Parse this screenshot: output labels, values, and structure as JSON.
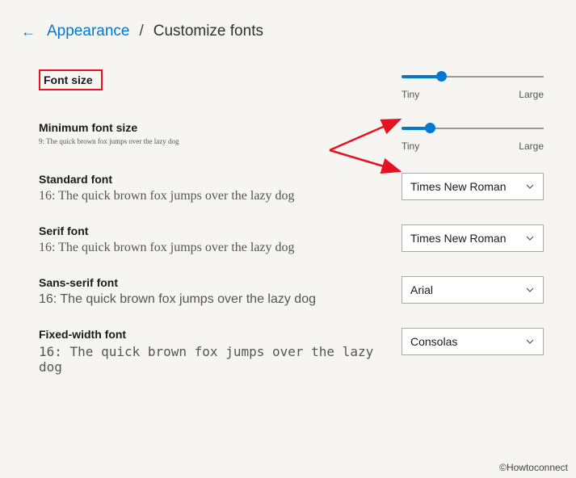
{
  "breadcrumb": {
    "back_icon": "←",
    "link": "Appearance",
    "separator": "/",
    "current": "Customize fonts"
  },
  "font_size": {
    "label": "Font size",
    "slider": {
      "min_label": "Tiny",
      "max_label": "Large",
      "percent": 28
    }
  },
  "min_font_size": {
    "label": "Minimum font size",
    "sample": "9: The quick brown fox jumps over the lazy dog",
    "slider": {
      "min_label": "Tiny",
      "max_label": "Large",
      "percent": 20
    }
  },
  "standard_font": {
    "label": "Standard font",
    "sample": "16: The quick brown fox jumps over the lazy dog",
    "value": "Times New Roman"
  },
  "serif_font": {
    "label": "Serif font",
    "sample": "16: The quick brown fox jumps over the lazy dog",
    "value": "Times New Roman"
  },
  "sans_serif_font": {
    "label": "Sans-serif font",
    "sample": "16: The quick brown fox jumps over the lazy dog",
    "value": "Arial"
  },
  "fixed_width_font": {
    "label": "Fixed-width font",
    "sample": "16: The quick brown fox jumps over the lazy dog",
    "value": "Consolas"
  },
  "watermark": "©Howtoconnect"
}
